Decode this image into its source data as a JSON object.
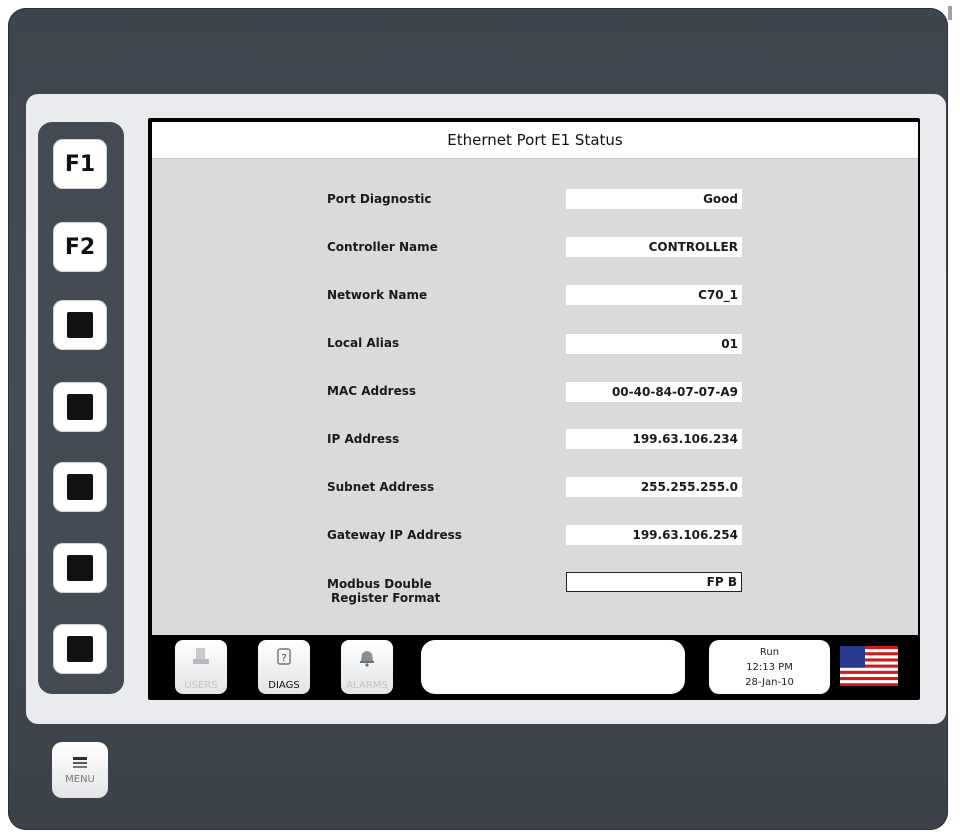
{
  "screen": {
    "title": "Ethernet Port E1 Status"
  },
  "function_keys": {
    "f1": "F1",
    "f2": "F2"
  },
  "rows": [
    {
      "label": "Port Diagnostic",
      "value": "Good"
    },
    {
      "label": "Controller Name",
      "value": "CONTROLLER"
    },
    {
      "label": "Network Name",
      "value": "C70_1"
    },
    {
      "label": "Local Alias",
      "value": "01"
    },
    {
      "label": "MAC Address",
      "value": "00-40-84-07-07-A9"
    },
    {
      "label": "IP Address",
      "value": "199.63.106.234"
    },
    {
      "label": "Subnet Address",
      "value": "255.255.255.0"
    },
    {
      "label": "Gateway IP Address",
      "value": "199.63.106.254"
    },
    {
      "label": "Modbus Double",
      "label2": "Register Format",
      "value": "FP B"
    }
  ],
  "nav": {
    "users": {
      "label": "USERS",
      "icon": "users-icon"
    },
    "diags": {
      "label": "DIAGS",
      "icon": "diags-icon"
    },
    "alarms": {
      "label": "ALARMS",
      "icon": "bell-icon"
    }
  },
  "status": {
    "mode": "Run",
    "time": "12:13 PM",
    "date": "28-Jan-10"
  },
  "menu": {
    "label": "MENU"
  },
  "colors": {
    "bezel": "#454b54",
    "panel": "#e9ebee",
    "screen_bg": "#d9dadb"
  }
}
